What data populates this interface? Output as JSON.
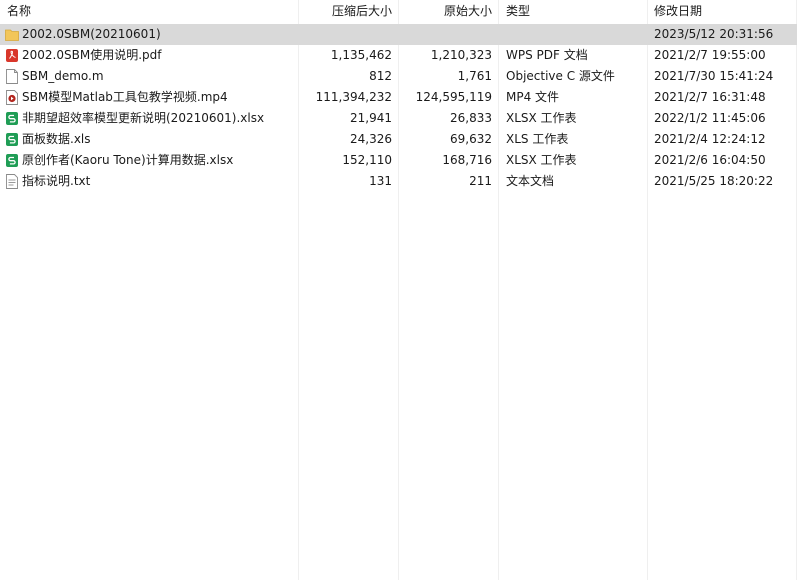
{
  "columns": {
    "name": "名称",
    "compressed": "压缩后大小",
    "original": "原始大小",
    "type": "类型",
    "modified": "修改日期",
    "sort_arrow": "^"
  },
  "files": [
    {
      "name": "2002.0SBM(20210601)",
      "compressed": "",
      "original": "",
      "type": "",
      "modified": "2023/5/12 20:31:56",
      "icon": "folder-icon"
    },
    {
      "name": "2002.0SBM使用说明.pdf",
      "compressed": "1,135,462",
      "original": "1,210,323",
      "type": "WPS PDF 文档",
      "modified": "2021/2/7 19:55:00",
      "icon": "pdf-file-icon"
    },
    {
      "name": "SBM_demo.m",
      "compressed": "812",
      "original": "1,761",
      "type": "Objective C 源文件",
      "modified": "2021/7/30 15:41:24",
      "icon": "blank-file-icon"
    },
    {
      "name": "SBM模型Matlab工具包教学视频.mp4",
      "compressed": "111,394,232",
      "original": "124,595,119",
      "type": "MP4 文件",
      "modified": "2021/2/7 16:31:48",
      "icon": "video-file-icon"
    },
    {
      "name": "非期望超效率模型更新说明(20210601).xlsx",
      "compressed": "21,941",
      "original": "26,833",
      "type": "XLSX 工作表",
      "modified": "2022/1/2 11:45:06",
      "icon": "spreadsheet-file-icon"
    },
    {
      "name": "面板数据.xls",
      "compressed": "24,326",
      "original": "69,632",
      "type": "XLS 工作表",
      "modified": "2021/2/4 12:24:12",
      "icon": "spreadsheet-file-icon"
    },
    {
      "name": "原创作者(Kaoru Tone)计算用数据.xlsx",
      "compressed": "152,110",
      "original": "168,716",
      "type": "XLSX 工作表",
      "modified": "2021/2/6 16:04:50",
      "icon": "spreadsheet-file-icon"
    },
    {
      "name": "指标说明.txt",
      "compressed": "131",
      "original": "211",
      "type": "文本文档",
      "modified": "2021/5/25 18:20:22",
      "icon": "text-file-icon"
    }
  ],
  "selected_index": 0,
  "colors": {
    "selected_row": "#d9d9d9",
    "folder": "#f2c65a",
    "pdf": "#d9372b",
    "spreadsheet": "#1f9d55",
    "video": "#b3261e"
  }
}
